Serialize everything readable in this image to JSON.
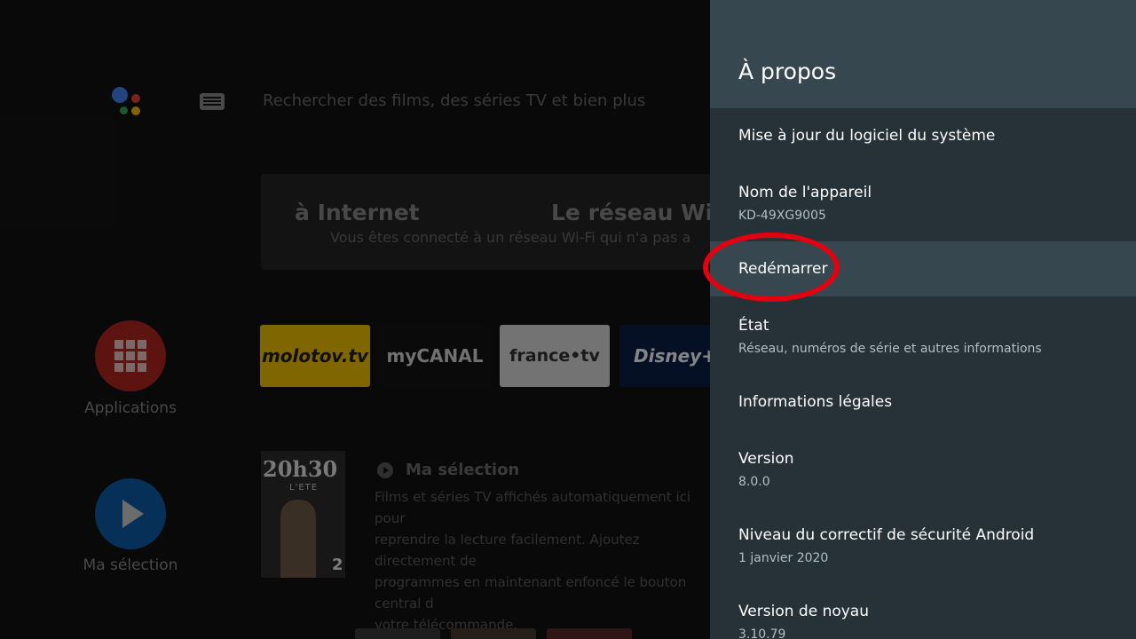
{
  "home": {
    "search_placeholder": "Rechercher des films, des séries TV et bien plus",
    "banner": {
      "title_left": "à Internet",
      "title_right": "Le réseau Wi-F",
      "subtitle": "Vous êtes connecté à un réseau Wi-Fi qui n'a pas a"
    },
    "sidebar": {
      "apps_label": "Applications",
      "selection_label": "Ma sélection"
    },
    "apps": [
      {
        "name": "molotov.tv"
      },
      {
        "name": "myCANAL"
      },
      {
        "name": "france•tv"
      },
      {
        "name": "Disney+"
      }
    ],
    "poster": {
      "title": "20h30",
      "subtitle": "L'ETE",
      "channel": "2"
    },
    "selection": {
      "title": "Ma sélection",
      "description": "Films et séries TV affichés automatiquement ici pour\nreprendre la lecture facilement. Ajoutez directement de\nprogrammes en maintenant enfoncé le bouton central d\nvotre télécommande."
    },
    "icons": {
      "assistant": "google-assistant-icon",
      "keyboard": "keyboard-icon"
    }
  },
  "settings_panel": {
    "title": "À propos",
    "items": [
      {
        "title": "Mise à jour du logiciel du système",
        "subtitle": ""
      },
      {
        "title": "Nom de l'appareil",
        "subtitle": "KD-49XG9005"
      },
      {
        "title": "Redémarrer",
        "subtitle": "",
        "focused": true
      },
      {
        "title": "État",
        "subtitle": "Réseau, numéros de série et autres informations"
      },
      {
        "title": "Informations légales",
        "subtitle": ""
      },
      {
        "title": "Version",
        "subtitle": "8.0.0"
      },
      {
        "title": "Niveau du correctif de sécurité Android",
        "subtitle": "1 janvier 2020"
      },
      {
        "title": "Version de noyau",
        "subtitle": "3.10.79"
      }
    ]
  },
  "colors": {
    "panel_bg": "#263238",
    "panel_header_bg": "#37474f",
    "focused_item_bg": "#37474f",
    "highlight_ring": "#e3000f"
  }
}
